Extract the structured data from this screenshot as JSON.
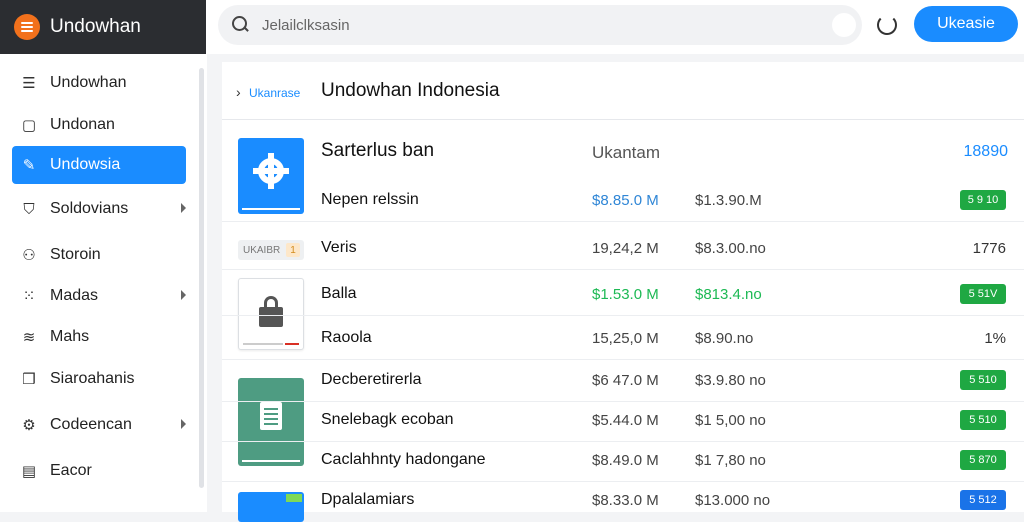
{
  "app": {
    "name": "Undowhan",
    "accent": "#1a8cff",
    "logo_color": "#f2711c"
  },
  "search": {
    "placeholder": "Jelailclksasin"
  },
  "header": {
    "cta_label": "Ukeasie",
    "refresh_icon": "refresh-icon"
  },
  "sidebar": {
    "items": [
      {
        "label": "Undowhan",
        "icon": "list-icon",
        "glyph": "☰",
        "active": false,
        "chevron": false
      },
      {
        "label": "Undonan",
        "icon": "square-icon",
        "glyph": "▢",
        "active": false,
        "chevron": false
      },
      {
        "label": "Undowsia",
        "icon": "pencil-icon",
        "glyph": "✎",
        "active": true,
        "chevron": false
      },
      {
        "label": "Soldovians",
        "icon": "shield-icon",
        "glyph": "⛉",
        "active": false,
        "chevron": true
      },
      {
        "label": "Storoin",
        "icon": "user-icon",
        "glyph": "⚇",
        "active": false,
        "chevron": false
      },
      {
        "label": "Madas",
        "icon": "grid-icon",
        "glyph": "⁙",
        "active": false,
        "chevron": true
      },
      {
        "label": "Mahs",
        "icon": "wave-icon",
        "glyph": "≋",
        "active": false,
        "chevron": false
      },
      {
        "label": "Siaroahanis",
        "icon": "cube-icon",
        "glyph": "❒",
        "active": false,
        "chevron": false
      },
      {
        "label": "Codeencan",
        "icon": "gear-icon",
        "glyph": "⚙",
        "active": false,
        "chevron": true
      },
      {
        "label": "Eacor",
        "icon": "folder-icon",
        "glyph": "▤",
        "active": false,
        "chevron": false
      }
    ]
  },
  "panel": {
    "breadcrumb": "Ukanrase",
    "title": "Undowhan Indonesia",
    "table": {
      "header": {
        "name": "Sarterlus ban",
        "col_a": "Ukantam",
        "col_r": "18890"
      },
      "rows": [
        {
          "name": "Nepen relssin",
          "a": "$8.85.0 M",
          "b": "$1.3.90.M",
          "r": "5 9 10",
          "a_color": "blue",
          "b_color": "",
          "r_style": "green"
        },
        {
          "name": "Veris",
          "a": "19,24,2 M",
          "b": "$8.3.00.no",
          "r": "1776",
          "a_color": "",
          "b_color": "",
          "r_style": "plain"
        },
        {
          "name": "Balla",
          "a": "$1.53.0 M",
          "b": "$813.4.no",
          "r": "5 51V",
          "a_color": "green",
          "b_color": "green",
          "r_style": "green"
        },
        {
          "name": "Raoola",
          "a": "15,25,0 M",
          "b": "$8.90.no",
          "r": "1%",
          "a_color": "",
          "b_color": "",
          "r_style": "plain"
        },
        {
          "name": "Decberetirerla",
          "a": "$6 47.0 M",
          "b": "$3.9.80 no",
          "r": "5 510",
          "a_color": "",
          "b_color": "",
          "r_style": "green"
        },
        {
          "name": "Snelebagk ecoban",
          "a": "$5.44.0 M",
          "b": "$1 5,00 no",
          "r": "5 510",
          "a_color": "",
          "b_color": "",
          "r_style": "green"
        },
        {
          "name": "Caclahhnty hadongane",
          "a": "$8.49.0 M",
          "b": "$1 7,80 no",
          "r": "5 870",
          "a_color": "",
          "b_color": "",
          "r_style": "green"
        },
        {
          "name": "Dpalalamiars",
          "a": "$8.33.0 M",
          "b": "$13.000 no",
          "r": "5 512",
          "a_color": "",
          "b_color": "",
          "r_style": "blue"
        }
      ]
    },
    "tag": {
      "label": "UKAIBR",
      "num": "1"
    }
  }
}
